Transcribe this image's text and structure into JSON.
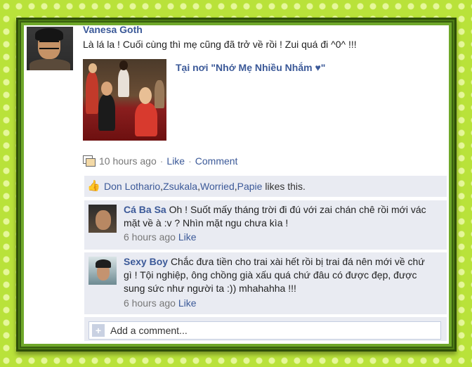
{
  "post": {
    "author": "Vanesa Goth",
    "status": "Là lá la ! Cuối cùng thì mẹ cũng đã trở về rồi ! Zui quá đi ^0^ !!!",
    "place": "Tại nơi \"Nhớ Mẹ Nhiều Nhắm ♥\"",
    "time": "10 hours ago",
    "like_label": "Like",
    "comment_label": "Comment",
    "separator": "·"
  },
  "likes": {
    "names": [
      {
        "name": "Don Lothario",
        "sep": ", "
      },
      {
        "name": "Zsukala",
        "sep": ", "
      },
      {
        "name": "Worried",
        "sep": ", "
      },
      {
        "name": "Papie",
        "sep": " "
      }
    ],
    "suffix": "likes this."
  },
  "comments": [
    {
      "author": "Cá Ba Sa",
      "text_line1": "Oh ! Suốt mấy tháng trời đi đú với zai chán chê rồi mới vác",
      "text_line2": "mặt về à :v ? Nhìn mặt ngu chưa kìa !",
      "time": "6 hours ago",
      "like_label": "Like"
    },
    {
      "author": "Sexy Boy",
      "text_line1": "Chắc đưa tiền cho trai xài hết rồi bị trai đá nên mới về chứ",
      "text_line2": "gì ! Tội nghiệp, ông chồng già xấu quá chứ đâu có được đẹp, được",
      "text_line3": "sung sức như người ta :)) mhahahha !!!",
      "time": "6 hours ago",
      "like_label": "Like"
    }
  ],
  "add_comment": {
    "placeholder": "Add a comment..."
  },
  "colors": {
    "link": "#3b5998",
    "panel": "#e9ebf2",
    "frame": "#6fa82a",
    "background": "#b9e23a"
  },
  "icons": {
    "photo": "photo-album-icon",
    "like": "thumbs-up-icon",
    "add": "plus-icon"
  }
}
